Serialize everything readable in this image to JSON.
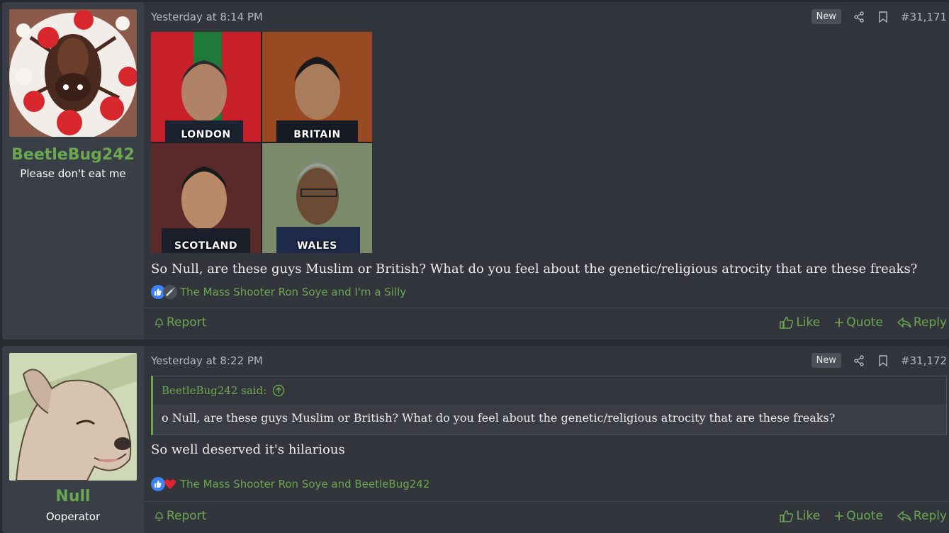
{
  "posts": [
    {
      "user": {
        "name": "BeetleBug242",
        "title": "Please don't eat me",
        "avatar_icon": "beetle-cake-avatar"
      },
      "date": "Yesterday at 8:14 PM",
      "badge": "New",
      "post_number": "#31,171",
      "image_labels": [
        "LONDON",
        "BRITAIN",
        "SCOTLAND",
        "WALES"
      ],
      "text": "So Null, are these guys Muslim or British? What do you feel about the genetic/religious atrocity that are these freaks?",
      "reactions": {
        "icons": [
          "like-icon",
          "syringe-icon"
        ],
        "text": "The Mass Shooter Ron Soye and I'm a Silly"
      },
      "footer": {
        "report": "Report",
        "like": "Like",
        "quote": "Quote",
        "reply": "Reply"
      }
    },
    {
      "user": {
        "name": "Null",
        "title": "Ooperator",
        "avatar_icon": "dog-avatar"
      },
      "date": "Yesterday at 8:22 PM",
      "badge": "New",
      "post_number": "#31,172",
      "quote": {
        "author": "BeetleBug242 said:",
        "text": "o Null, are these guys Muslim or British? What do you feel about the genetic/religious atrocity that are these freaks?"
      },
      "text": "So well deserved it's hilarious",
      "reactions": {
        "icons": [
          "like-icon",
          "heart-icon"
        ],
        "text": "The Mass Shooter Ron Soye and BeetleBug242"
      },
      "footer": {
        "report": "Report",
        "like": "Like",
        "quote": "Quote",
        "reply": "Reply"
      }
    }
  ],
  "colors": {
    "accent": "#6aa84f",
    "post_bg": "#32353c",
    "user_bg": "#3a3e46"
  }
}
